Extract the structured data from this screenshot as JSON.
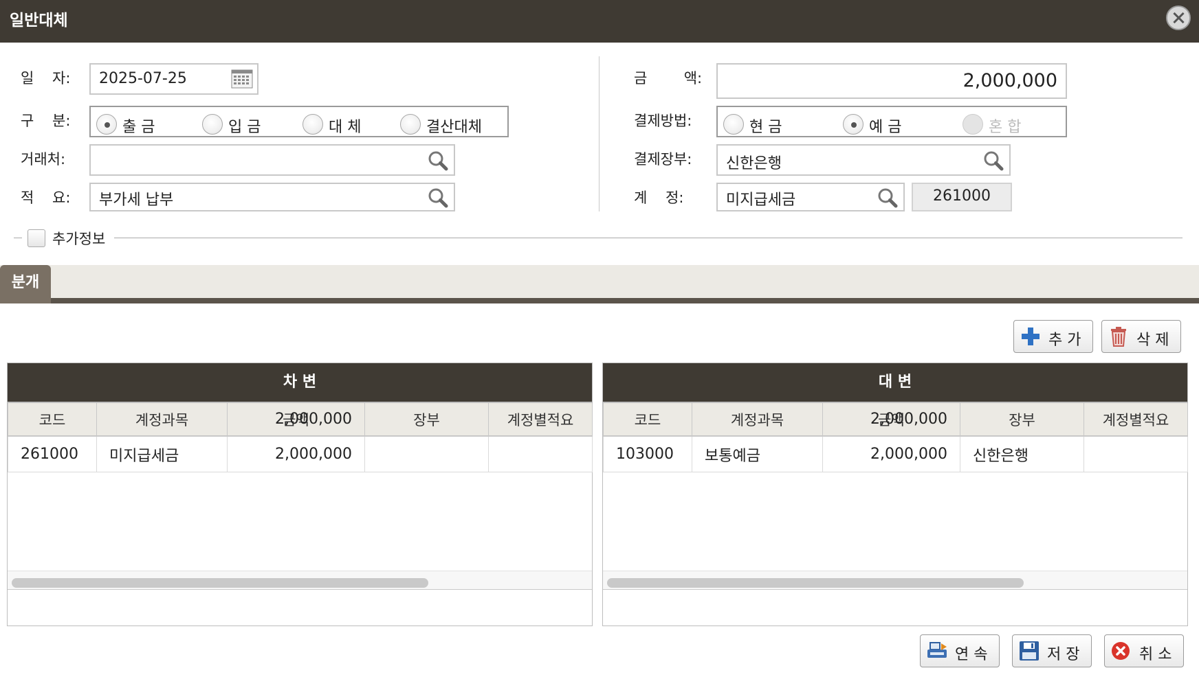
{
  "window": {
    "title": "일반대체"
  },
  "form": {
    "date": {
      "label": "일    자:",
      "value": "2025-07-25"
    },
    "category": {
      "label": "구    분:",
      "options": [
        {
          "label": "출 금",
          "selected": true
        },
        {
          "label": "입 금",
          "selected": false
        },
        {
          "label": "대 체",
          "selected": false
        },
        {
          "label": "결산대체",
          "selected": false
        }
      ]
    },
    "partner": {
      "label": "거래처:",
      "value": ""
    },
    "memo": {
      "label": "적    요:",
      "value": "부가세 납부"
    },
    "amount": {
      "label": "금        액:",
      "value": "2,000,000"
    },
    "payment_method": {
      "label": "결제방법:",
      "options": [
        {
          "label": "현 금",
          "selected": false,
          "disabled": false
        },
        {
          "label": "예 금",
          "selected": true,
          "disabled": false
        },
        {
          "label": "혼 합",
          "selected": false,
          "disabled": true
        }
      ]
    },
    "payment_ledger": {
      "label": "결제장부:",
      "value": "신한은행"
    },
    "account": {
      "label": "계    정:",
      "value": "미지급세금",
      "code": "261000"
    },
    "extra_info": {
      "label": "추가정보",
      "checked": false
    }
  },
  "tabs": [
    {
      "label": "분개",
      "active": true
    }
  ],
  "toolbar": {
    "add_label": "추 가",
    "delete_label": "삭 제"
  },
  "debit": {
    "title": "차 변",
    "columns": [
      "코드",
      "계정과목",
      "금액",
      "장부",
      "계정별적요"
    ],
    "rows": [
      {
        "code": "261000",
        "account": "미지급세금",
        "amount": "2,000,000",
        "ledger": "",
        "memo": ""
      }
    ],
    "total": "2,000,000"
  },
  "credit": {
    "title": "대 변",
    "columns": [
      "코드",
      "계정과목",
      "금액",
      "장부",
      "계정별적요"
    ],
    "rows": [
      {
        "code": "103000",
        "account": "보통예금",
        "amount": "2,000,000",
        "ledger": "신한은행",
        "memo": ""
      }
    ],
    "total": "2,000,000"
  },
  "footer": {
    "continue_label": "연 속",
    "save_label": "저 장",
    "cancel_label": "취 소"
  },
  "colors": {
    "header_bg": "#3f3a33",
    "tab_bg": "#7a7064",
    "add_icon": "#2f72c4",
    "cancel_icon": "#d9342b"
  }
}
